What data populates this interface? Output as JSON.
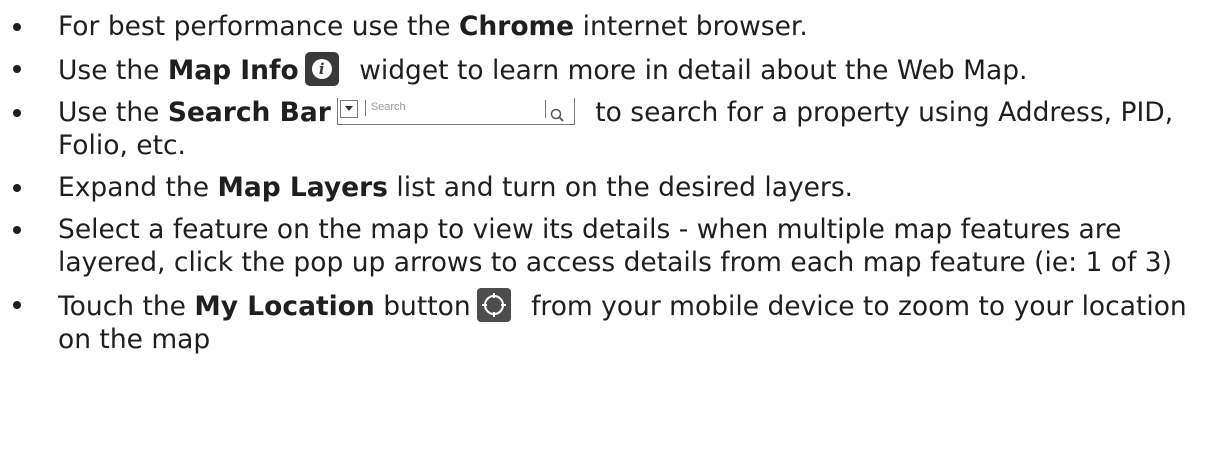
{
  "items": [
    {
      "pre": "For best performance use the ",
      "bold": "Chrome",
      "post": " internet browser."
    },
    {
      "pre": "Use the ",
      "bold": "Map Info",
      "post": " widget to learn more in detail about the Web Map.",
      "icon": "info-icon"
    },
    {
      "pre": "Use the ",
      "bold": "Search Bar",
      "post": " to search for a property using Address, PID, Folio, etc.",
      "search_placeholder": "Search"
    },
    {
      "pre": "Expand the ",
      "bold": "Map Layers",
      "post": " list and turn on the desired layers."
    },
    {
      "text": "Select a feature on the map to view its details - when multiple map features are layered, click the pop up arrows to access details from each map feature (ie: 1 of 3)"
    },
    {
      "pre": "Touch the ",
      "bold": "My Location",
      "mid": " button",
      "post": " from your mobile device to zoom to your location on the map",
      "icon": "crosshair-icon"
    }
  ]
}
